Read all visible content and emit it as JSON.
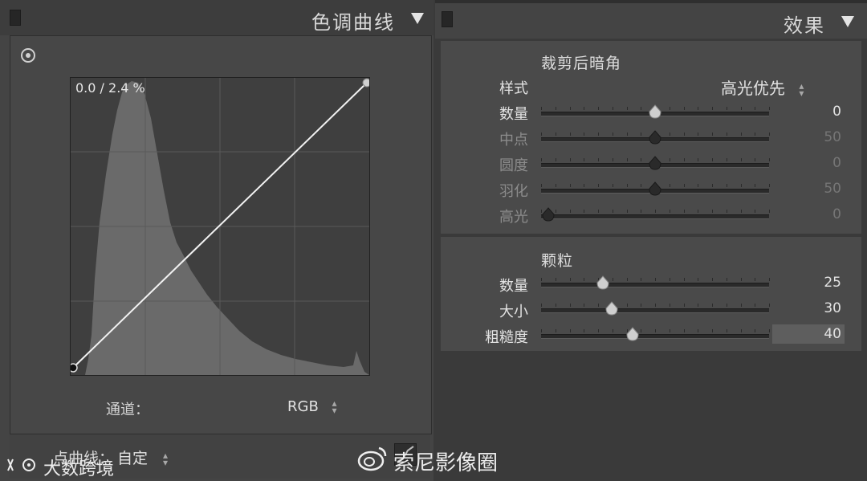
{
  "curve_panel": {
    "title": "色调曲线",
    "readout": "0.0 / 2.4 %",
    "channel_label": "通道：",
    "channel_value": "RGB",
    "point_curve_label": "点曲线：",
    "point_curve_value": "自定"
  },
  "effects_panel": {
    "title": "效果",
    "vignette": {
      "title": "裁剪后暗角",
      "style_label": "样式",
      "style_value": "高光优先",
      "rows": [
        {
          "label": "数量",
          "value": "0",
          "enabled": true
        },
        {
          "label": "中点",
          "value": "50",
          "enabled": false
        },
        {
          "label": "圆度",
          "value": "0",
          "enabled": false
        },
        {
          "label": "羽化",
          "value": "50",
          "enabled": false
        },
        {
          "label": "高光",
          "value": "0",
          "enabled": false
        }
      ]
    },
    "grain": {
      "title": "颗粒",
      "rows": [
        {
          "label": "数量",
          "value": "25",
          "enabled": true
        },
        {
          "label": "大小",
          "value": "30",
          "enabled": true
        },
        {
          "label": "粗糙度",
          "value": "40",
          "enabled": true
        }
      ]
    }
  },
  "watermarks": {
    "left": "大数跨境",
    "right": "索尼影像圈"
  },
  "icons": {
    "collapse": "panel-collapse-icon",
    "disclosure": "disclosure-triangle-icon",
    "target": "targeted-adjustment-icon",
    "stepper": "up-down-stepper-icon",
    "edit_points": "edit-point-curve-icon",
    "weibo": "weibo-logo-icon"
  },
  "slider_levels": {
    "vignette": [
      0.5,
      0.5,
      0.5,
      0.5,
      0.03
    ],
    "grain": [
      0.27,
      0.31,
      0.4
    ]
  }
}
